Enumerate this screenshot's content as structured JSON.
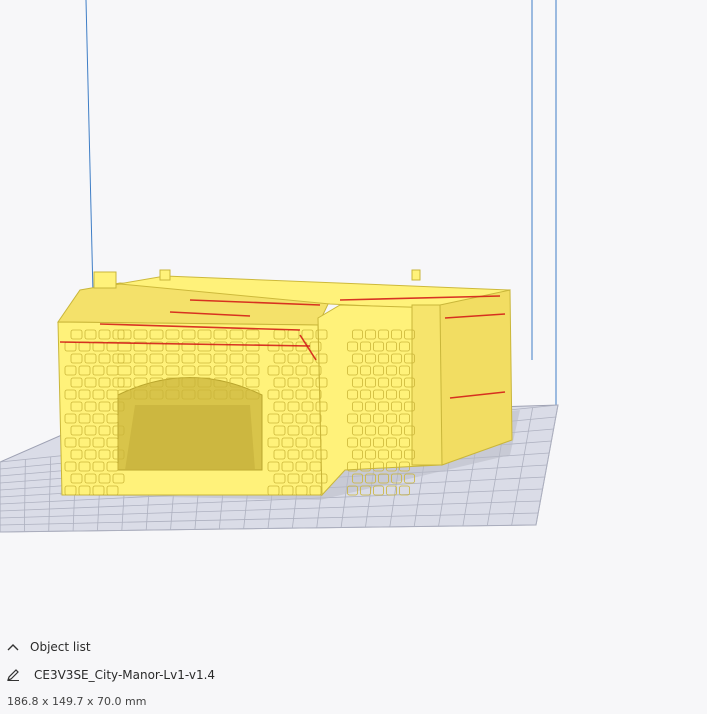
{
  "object_list": {
    "header_label": "Object list",
    "toggle_icon": "chevron-up-icon"
  },
  "object": {
    "name": "CE3V3SE_City-Manor-Lv1-v1.4",
    "edit_icon": "pencil-icon",
    "dimensions": "186.8 x 149.7 x 70.0 mm"
  },
  "colors": {
    "background": "#f7f7f9",
    "build_plate": "#d9dbe6",
    "grid_line": "#a9acbb",
    "volume_edge": "#3f7ec6",
    "model": "#fff27a",
    "model_shade": "#e8d54a",
    "overhang": "#d21414"
  }
}
